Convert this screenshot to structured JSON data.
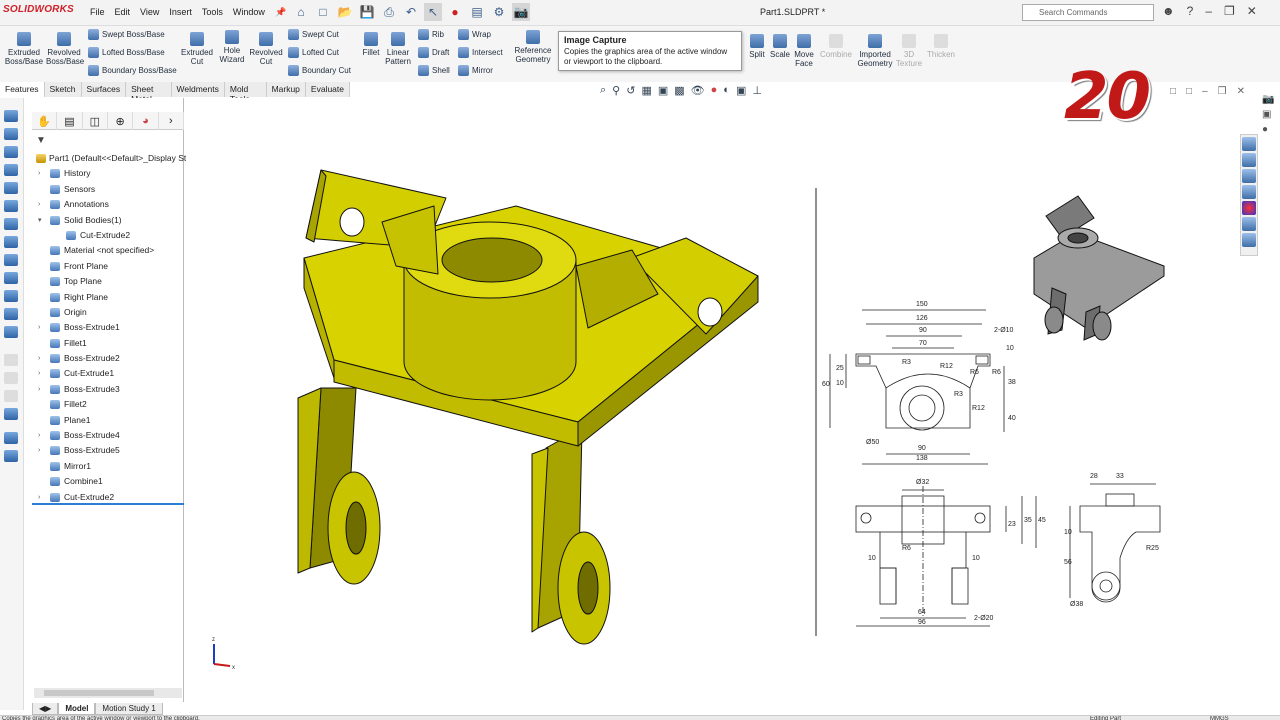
{
  "app": {
    "name": "SOLIDWORKS",
    "document_title": "Part1.SLDPRT *"
  },
  "menu": [
    "File",
    "Edit",
    "View",
    "Insert",
    "Tools",
    "Window"
  ],
  "search": {
    "placeholder": "Search Commands"
  },
  "ribbon": {
    "extruded_boss": "Extruded Boss/Base",
    "revolved_boss": "Revolved Boss/Base",
    "swept_boss": "Swept Boss/Base",
    "lofted_boss": "Lofted Boss/Base",
    "boundary_boss": "Boundary Boss/Base",
    "extruded_cut": "Extruded Cut",
    "hole_wizard": "Hole Wizard",
    "revolved_cut": "Revolved Cut",
    "swept_cut": "Swept Cut",
    "lofted_cut": "Lofted Cut",
    "boundary_cut": "Boundary Cut",
    "fillet": "Fillet",
    "linear_pattern": "Linear Pattern",
    "rib": "Rib",
    "draft": "Draft",
    "shell": "Shell",
    "wrap": "Wrap",
    "intersect": "Intersect",
    "mirror": "Mirror",
    "reference_geometry": "Reference Geometry",
    "split": "Split",
    "scale": "Scale",
    "move_face": "Move Face",
    "combine": "Combine",
    "imported_geometry": "Imported Geometry",
    "texture_3d": "3D Texture",
    "thicken": "Thicken"
  },
  "tooltip": {
    "title": "Image Capture",
    "body": "Copies the graphics area of the active window or viewport to the clipboard."
  },
  "command_tabs": [
    "Features",
    "Sketch",
    "Surfaces",
    "Sheet Metal",
    "Weldments",
    "Mold Tools",
    "Markup",
    "Evaluate"
  ],
  "tree": {
    "root": "Part1  (Default<<Default>_Display Sta",
    "items": [
      "History",
      "Sensors",
      "Annotations",
      "Solid Bodies(1)",
      "Cut-Extrude2",
      "Material <not specified>",
      "Front Plane",
      "Top Plane",
      "Right Plane",
      "Origin",
      "Boss-Extrude1",
      "Fillet1",
      "Boss-Extrude2",
      "Cut-Extrude1",
      "Boss-Extrude3",
      "Fillet2",
      "Plane1",
      "Boss-Extrude4",
      "Boss-Extrude5",
      "Mirror1",
      "Combine1",
      "Cut-Extrude2"
    ]
  },
  "badge": "20",
  "bottom_tabs": [
    "Model",
    "Motion Study 1"
  ],
  "drawing": {
    "front": {
      "d150": "150",
      "d126": "126",
      "d90top": "90",
      "d70": "70",
      "d2010": "2-Ø10",
      "d10a": "10",
      "d25": "25",
      "d10b": "10",
      "d60": "60",
      "d38": "38",
      "d40": "40",
      "r3a": "R3",
      "r12a": "R12",
      "r6a": "R6",
      "r6b": "R6",
      "r3b": "R3",
      "r12b": "R12",
      "d50": "Ø50",
      "d90b": "90",
      "d138": "138"
    },
    "bottom": {
      "d32": "Ø32",
      "d23": "23",
      "d35": "35",
      "d45": "45",
      "r6": "R6",
      "d10l": "10",
      "d10r": "10",
      "d64": "64",
      "d96": "96",
      "d220": "2-Ø20"
    },
    "side": {
      "d28": "28",
      "d33": "33",
      "d10": "10",
      "d56": "56",
      "r25": "R25",
      "d38": "Ø38"
    }
  },
  "triad": {
    "x": "x",
    "z": "z"
  },
  "status": {
    "text": "Copies the graphics area of the active window or viewport to the clipboard.",
    "mode": "Editing Part",
    "units": "MMGS"
  },
  "colors": {
    "part_yellow": "#c9c400",
    "brand_red": "#d0202a"
  }
}
